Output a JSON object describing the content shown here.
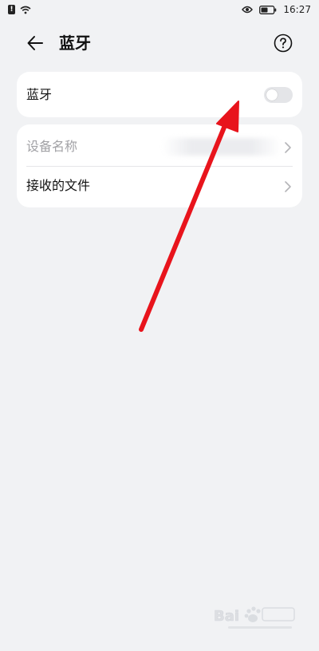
{
  "status_bar": {
    "time": "16:27",
    "icons": [
      "alert-icon",
      "wifi-icon",
      "eye-icon",
      "battery-icon"
    ]
  },
  "header": {
    "title": "蓝牙",
    "back_icon": "arrow-left-icon",
    "help_icon": "help-circle-icon"
  },
  "bluetooth_card": {
    "label": "蓝牙",
    "toggle_on": false
  },
  "settings_list": {
    "items": [
      {
        "label": "设备名称",
        "value_obscured": true
      },
      {
        "label": "接收的文件"
      }
    ]
  },
  "colors": {
    "background": "#f1f2f4",
    "card": "#ffffff",
    "toggle_off": "#e4e5e8",
    "secondary_text": "#a2a2a6",
    "annotation_arrow": "#e8141c"
  }
}
